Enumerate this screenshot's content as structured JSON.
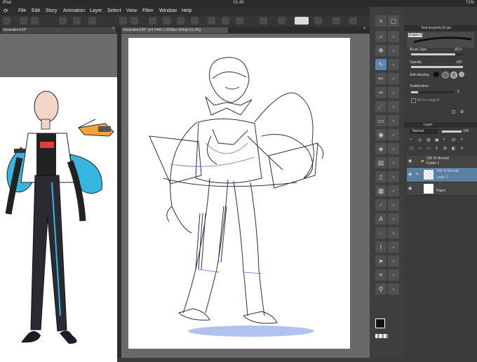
{
  "status": {
    "device": "iPad",
    "time": "01:43",
    "battery": "71%"
  },
  "menu": [
    "File",
    "Edit",
    "Story",
    "Animation",
    "Layer",
    "Select",
    "View",
    "Filter",
    "Window",
    "Help"
  ],
  "tabs": {
    "left": "Illustration192*",
    "main": "Illustration195* (A4 2480 x 3508px 300dpi 51.0%)"
  },
  "tool_property": {
    "header": "Tool property [G-pe",
    "brush_name": "G-pen 3",
    "brush_size_label": "Brush Size",
    "brush_size_value": "20.0",
    "opacity_label": "Opacity",
    "opacity_value": "100",
    "opacity_level": 1.0,
    "brush_size_level": 0.85,
    "antialias_label": "Anti-aliasing",
    "stabilization_label": "Stabilization",
    "stabilization_value": "6",
    "vector_label": "Vector magnet"
  },
  "layer_panel": {
    "header": "Layer",
    "blend_mode": "Normal",
    "opacity": "100",
    "layers": [
      {
        "percent": "100 % Normal",
        "name": "Folder 1",
        "selected": false,
        "type": "folder"
      },
      {
        "percent": "100 % Normal",
        "name": "Layer 2",
        "selected": true,
        "type": "raster"
      },
      {
        "percent": "",
        "name": "Paper",
        "selected": false,
        "type": "paper"
      }
    ]
  },
  "colors": {
    "accent": "#5d86ae",
    "sketch_blue": "#3355cc",
    "selected_layer": "#5b7ea3"
  }
}
